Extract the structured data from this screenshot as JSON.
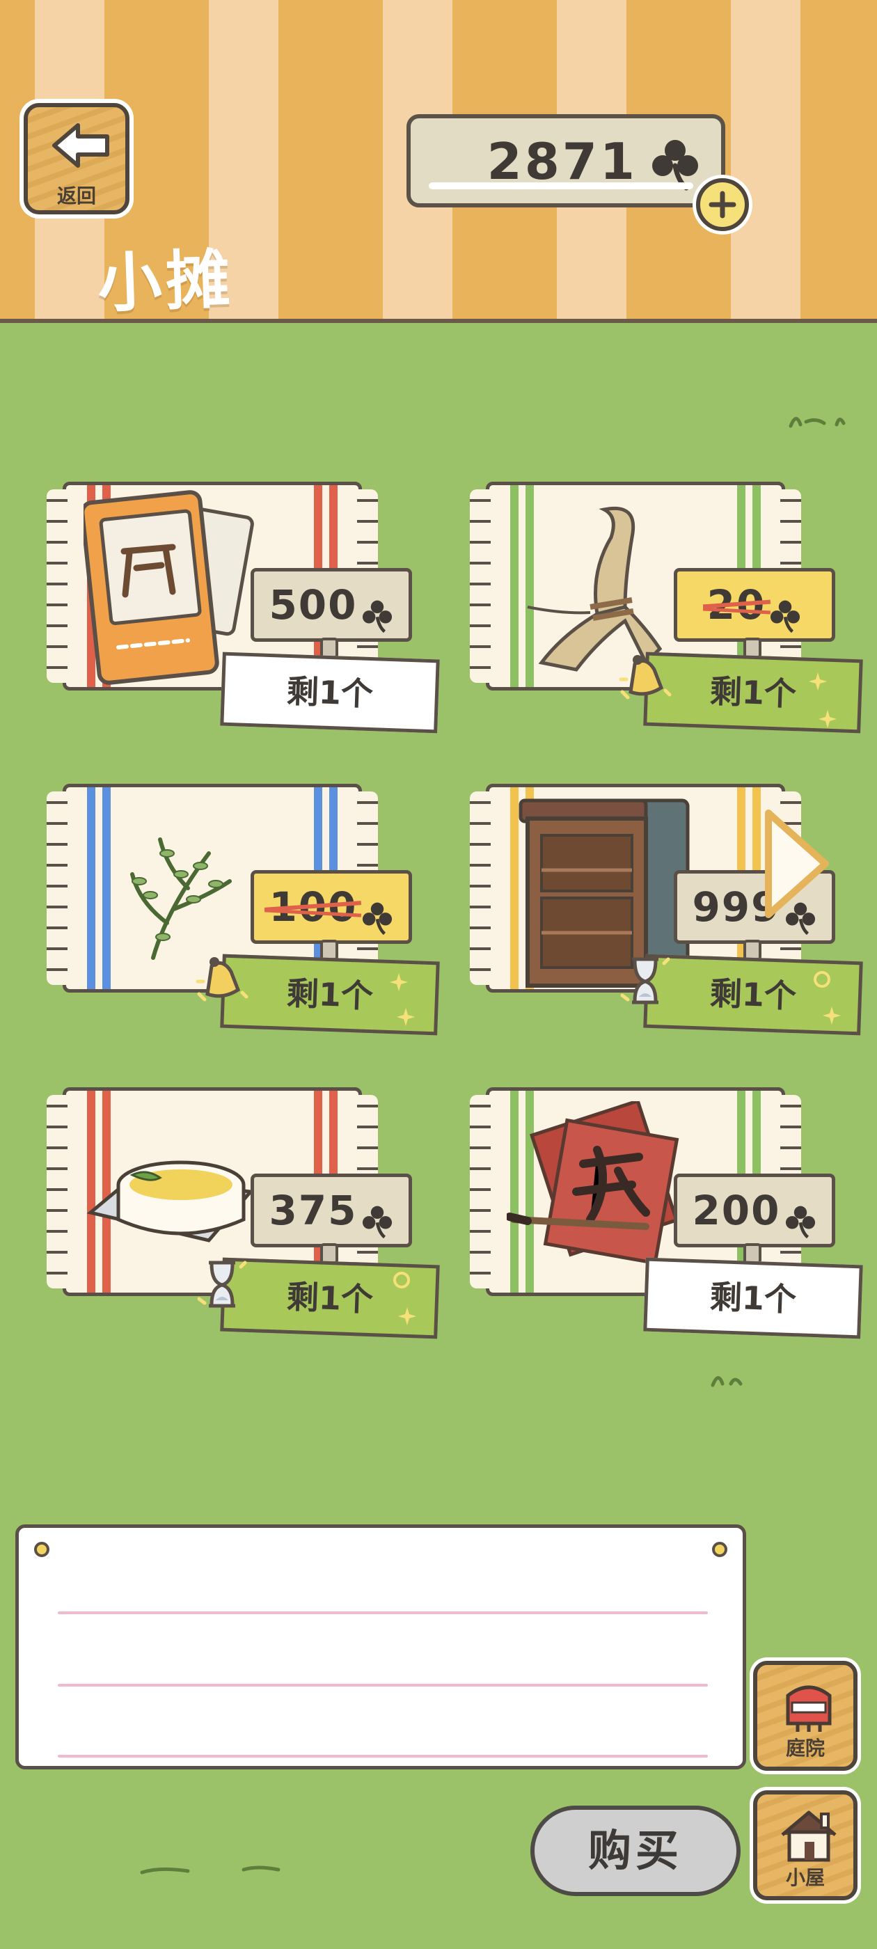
{
  "header": {
    "back_label": "返回",
    "title": "小摊",
    "coins": "2871"
  },
  "items": [
    {
      "name": "stool-card",
      "price": "500",
      "sale": false,
      "stock": "剩1个",
      "stock_style": "white",
      "badge": "none"
    },
    {
      "name": "straw-bundle",
      "price": "20",
      "sale": true,
      "stock": "剩1个",
      "stock_style": "green",
      "badge": "bell"
    },
    {
      "name": "herb-sprig",
      "price": "100",
      "sale": true,
      "stock": "剩1个",
      "stock_style": "green",
      "badge": "bell"
    },
    {
      "name": "wooden-cabinet",
      "price": "999",
      "sale": false,
      "stock": "剩1个",
      "stock_style": "green",
      "badge": "hourglass"
    },
    {
      "name": "dish-on-tray",
      "price": "375",
      "sale": false,
      "stock": "剩1个",
      "stock_style": "green",
      "badge": "hourglass"
    },
    {
      "name": "calligraphy-paper",
      "price": "200",
      "sale": false,
      "stock": "剩1个",
      "stock_style": "white",
      "badge": "none"
    }
  ],
  "footer": {
    "buy_label": "购买",
    "yard_label": "庭院",
    "house_label": "小屋"
  },
  "colors": {
    "grass": "#9bc268",
    "stripe_dark": "#e8b35a",
    "stripe_light": "#f5d3a6",
    "sale_tag": "#f5d866",
    "strike": "#e0614a"
  }
}
